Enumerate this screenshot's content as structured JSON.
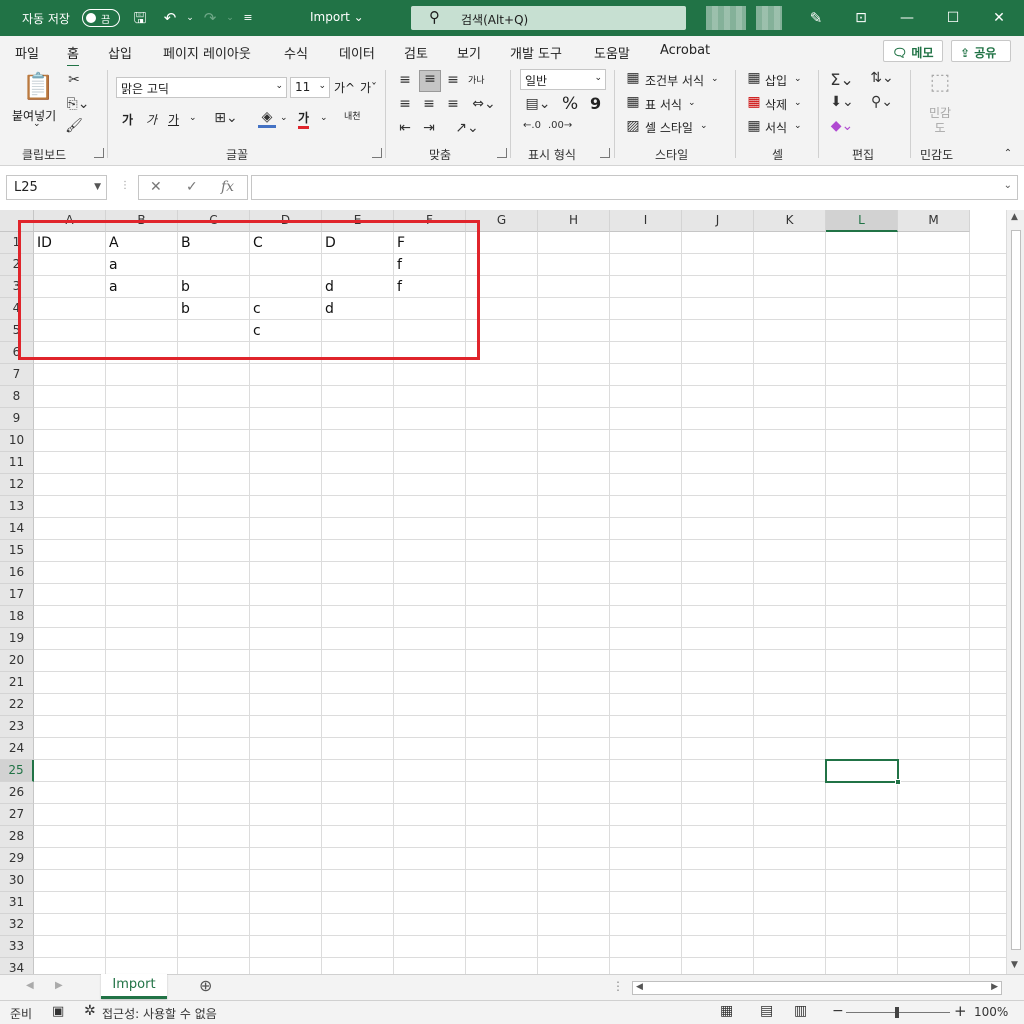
{
  "titlebar": {
    "autosave_label": "자동 저장",
    "autosave_state": "끔",
    "doc_title": "Import ⌄",
    "search_placeholder": "검색(Alt+Q)",
    "accent": "#217346"
  },
  "menu": {
    "tabs": [
      "파일",
      "홈",
      "삽입",
      "페이지 레이아웃",
      "수식",
      "데이터",
      "검토",
      "보기",
      "개발 도구",
      "도움말",
      "Acrobat"
    ],
    "active": "홈",
    "memo_label": "메모",
    "share_label": "공유"
  },
  "ribbon": {
    "clipboard": {
      "paste": "붙여넣기",
      "label": "클립보드"
    },
    "font": {
      "name": "맑은 고딕",
      "size": "11",
      "grow": "가^",
      "shrink": "가ˇ",
      "bold": "가",
      "italic": "가",
      "underline": "가",
      "font_color": "가",
      "phonetic": "내천",
      "label": "글꼴"
    },
    "alignment": {
      "wrap": "가나",
      "label": "맞춤"
    },
    "number": {
      "format": "일반",
      "percent": "%",
      "comma": "9",
      "label": "표시 형식"
    },
    "styles": {
      "conditional": "조건부 서식",
      "table": "표 서식",
      "cell_style": "셀 스타일",
      "label": "스타일"
    },
    "cells": {
      "insert": "삽입",
      "delete": "삭제",
      "format": "서식",
      "label": "셀"
    },
    "editing": {
      "label": "편집"
    },
    "sensitivity": {
      "button": "민감도",
      "label": "민감도"
    }
  },
  "formula_bar": {
    "name_box": "L25",
    "cancel": "✕",
    "confirm": "✓",
    "fx": "fx",
    "value": ""
  },
  "grid": {
    "columns": [
      "A",
      "B",
      "C",
      "D",
      "E",
      "F",
      "G",
      "H",
      "I",
      "J",
      "K",
      "L",
      "M"
    ],
    "rows": [
      "1",
      "2",
      "3",
      "4",
      "5",
      "6",
      "7",
      "8",
      "9",
      "10",
      "11",
      "12",
      "13",
      "14",
      "15",
      "16",
      "17",
      "18",
      "19",
      "20",
      "21",
      "22",
      "23",
      "24",
      "25",
      "26",
      "27",
      "28",
      "29",
      "30",
      "31",
      "32",
      "33",
      "34"
    ],
    "selected_cell": "L25",
    "cells": [
      [
        "ID",
        "A",
        "B",
        "C",
        "D",
        "F"
      ],
      [
        "",
        "a",
        "",
        "",
        "",
        "f"
      ],
      [
        "",
        "a",
        "b",
        "",
        "d",
        "f"
      ],
      [
        "",
        "",
        "b",
        "c",
        "d",
        ""
      ],
      [
        "",
        "",
        "",
        "c",
        "",
        ""
      ]
    ],
    "highlight_color": "#e0242b"
  },
  "sheets": {
    "tabs": [
      "Import"
    ],
    "active": "Import"
  },
  "status": {
    "ready": "준비",
    "accessibility": "접근성: 사용할 수 없음",
    "zoom": "100%"
  }
}
